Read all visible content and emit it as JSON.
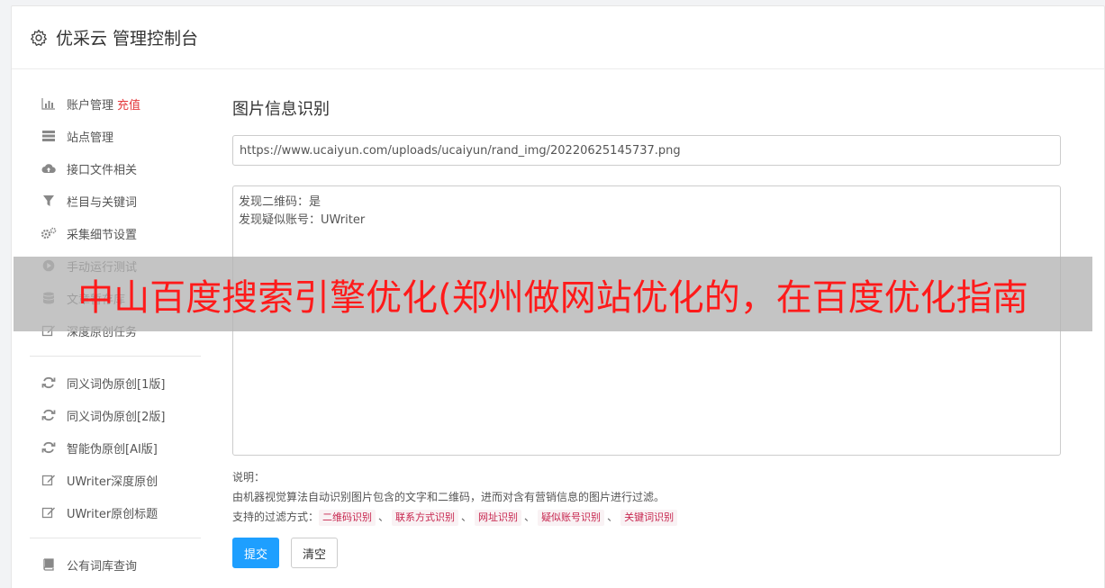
{
  "header": {
    "icon": "gear-icon",
    "title": "优采云 管理控制台"
  },
  "sidebar": {
    "groups": [
      [
        {
          "name": "account",
          "icon": "bar-chart-icon",
          "label": "账户管理",
          "extra": "充值"
        },
        {
          "name": "sites",
          "icon": "server-icon",
          "label": "站点管理"
        },
        {
          "name": "interface",
          "icon": "cloud-upload-icon",
          "label": "接口文件相关"
        },
        {
          "name": "columns",
          "icon": "filter-icon",
          "label": "栏目与关键词"
        },
        {
          "name": "collect",
          "icon": "cogs-icon",
          "label": "采集细节设置"
        },
        {
          "name": "manual-run",
          "icon": "play-circle-icon",
          "label": "手动运行测试"
        },
        {
          "name": "article-store",
          "icon": "database-icon",
          "label": "文章暂存库"
        },
        {
          "name": "deep-original",
          "icon": "edit-icon",
          "label": "深度原创任务"
        }
      ],
      [
        {
          "name": "synonym-v1",
          "icon": "refresh-icon",
          "label": "同义词伪原创[1版]"
        },
        {
          "name": "synonym-v2",
          "icon": "refresh-icon",
          "label": "同义词伪原创[2版]"
        },
        {
          "name": "ai-rewrite",
          "icon": "refresh-icon",
          "label": "智能伪原创[AI版]"
        },
        {
          "name": "uwriter-deep",
          "icon": "edit-icon",
          "label": "UWriter深度原创"
        },
        {
          "name": "uwriter-title",
          "icon": "edit-icon",
          "label": "UWriter原创标题"
        }
      ],
      [
        {
          "name": "public-thesaurus",
          "icon": "book-icon",
          "label": "公有词库查询"
        }
      ]
    ]
  },
  "main": {
    "title": "图片信息识别",
    "url_value": "https://www.ucaiyun.com/uploads/ucaiyun/rand_img/20220625145737.png",
    "result_lines": [
      "发现二维码：是",
      "发现疑似账号：UWriter"
    ],
    "help": {
      "heading": "说明：",
      "description": "由机器视觉算法自动识别图片包含的文字和二维码，进而对含有营销信息的图片进行过滤。",
      "filters_label": "支持的过滤方式：",
      "filters": [
        "二维码识别",
        "联系方式识别",
        "网址识别",
        "疑似账号识别",
        "关键词识别"
      ],
      "separator": "、"
    },
    "submit_label": "提交",
    "clear_label": "清空"
  },
  "overlay_banner": "中山百度搜索引擎优化(郑州做网站优化的，在百度优化指南",
  "colors": {
    "primary": "#1e9fff",
    "recharge": "#e4393c",
    "banner_text": "#ff1a1a",
    "tag_text": "#c7254e"
  }
}
